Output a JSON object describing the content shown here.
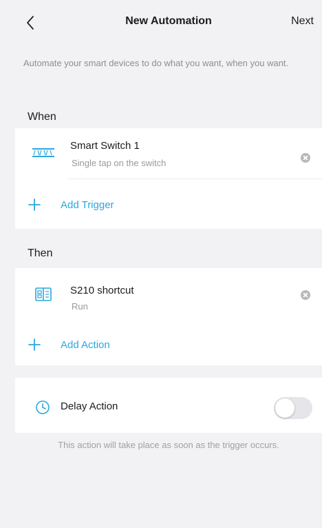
{
  "header": {
    "title": "New Automation",
    "next_label": "Next"
  },
  "intro_text": "Automate your smart devices to do what you want, when you want.",
  "when": {
    "label": "When",
    "trigger": {
      "name": "Smart Switch 1",
      "detail": "Single tap on the switch",
      "icon": "smart-switch-icon"
    },
    "add_label": "Add Trigger"
  },
  "then": {
    "label": "Then",
    "action": {
      "name": "S210 shortcut",
      "detail": "Run",
      "icon": "shortcut-icon"
    },
    "add_label": "Add Action"
  },
  "delay": {
    "label": "Delay Action",
    "enabled": false
  },
  "footnote": "This action will take place as soon as the trigger occurs.",
  "colors": {
    "accent": "#2aa7de",
    "background": "#f2f2f4",
    "card": "#ffffff"
  }
}
